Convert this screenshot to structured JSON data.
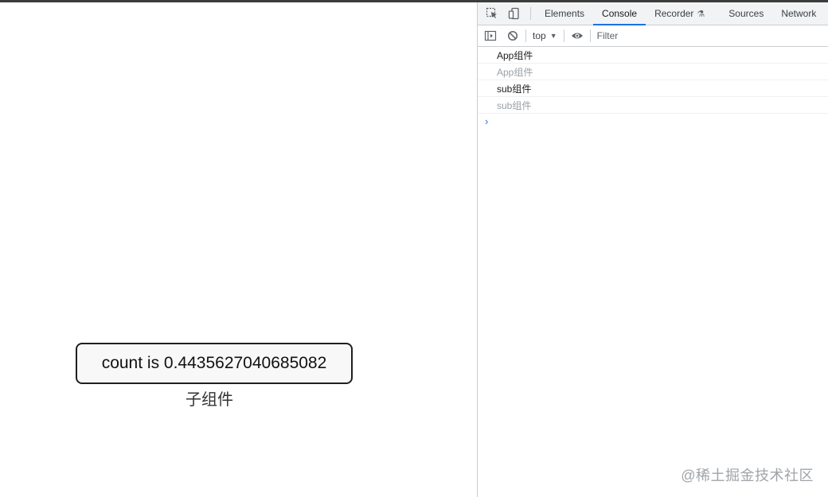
{
  "app": {
    "count_button_label": "count is 0.4435627040685082",
    "child_component_label": "子组件"
  },
  "devtools": {
    "tabs": [
      {
        "label": "Elements"
      },
      {
        "label": "Console"
      },
      {
        "label": "Recorder"
      },
      {
        "label": "Sources"
      },
      {
        "label": "Network"
      }
    ],
    "active_tab": "Console",
    "toolbar": {
      "context": "top",
      "filter_placeholder": "Filter"
    },
    "console_lines": [
      {
        "text": "App组件"
      },
      {
        "text": "App组件"
      },
      {
        "text": "sub组件"
      },
      {
        "text": "sub组件"
      }
    ],
    "prompt_symbol": "›"
  },
  "watermark": "@稀土掘金技术社区"
}
